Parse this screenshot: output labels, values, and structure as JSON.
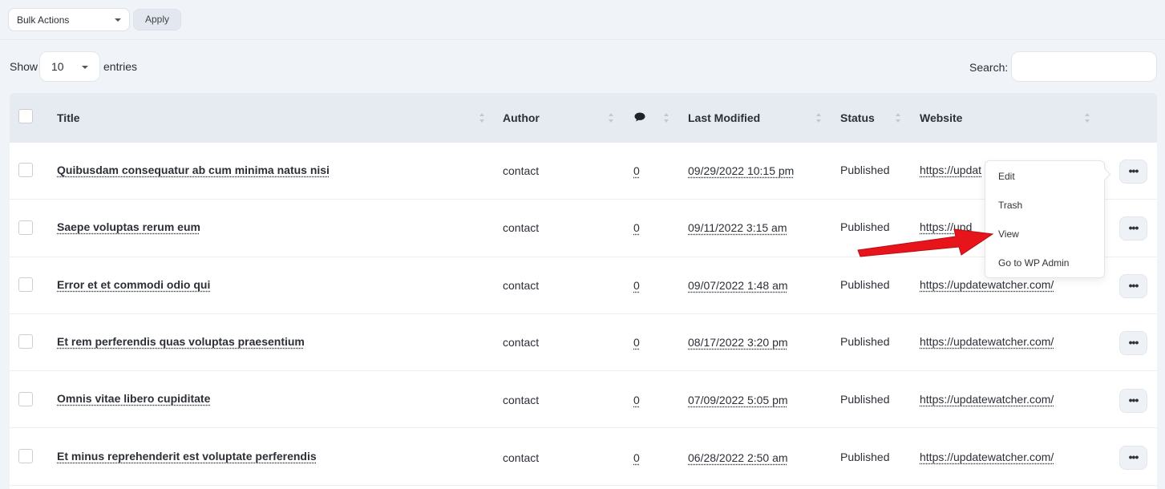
{
  "toolbar": {
    "bulk_actions": "Bulk Actions",
    "apply": "Apply"
  },
  "entries": {
    "show_label": "Show",
    "value": "10",
    "suffix": "entries"
  },
  "search": {
    "label": "Search:",
    "value": ""
  },
  "table": {
    "headers": {
      "title": "Title",
      "author": "Author",
      "comments_icon": "comment-icon",
      "last_modified": "Last Modified",
      "status": "Status",
      "website": "Website"
    },
    "rows": [
      {
        "title": "Quibusdam consequatur ab cum minima natus nisi",
        "author": "contact",
        "comments": "0",
        "modified": "09/29/2022 10:15 pm",
        "status": "Published",
        "website": "https://updat"
      },
      {
        "title": "Saepe voluptas rerum eum",
        "author": "contact",
        "comments": "0",
        "modified": "09/11/2022 3:15 am",
        "status": "Published",
        "website": "https://upd"
      },
      {
        "title": "Error et et commodi odio qui",
        "author": "contact",
        "comments": "0",
        "modified": "09/07/2022 1:48 am",
        "status": "Published",
        "website": "https://updatewatcher.com/"
      },
      {
        "title": "Et rem perferendis quas voluptas praesentium",
        "author": "contact",
        "comments": "0",
        "modified": "08/17/2022 3:20 pm",
        "status": "Published",
        "website": "https://updatewatcher.com/"
      },
      {
        "title": "Omnis vitae libero cupiditate",
        "author": "contact",
        "comments": "0",
        "modified": "07/09/2022 5:05 pm",
        "status": "Published",
        "website": "https://updatewatcher.com/"
      },
      {
        "title": "Et minus reprehenderit est voluptate perferendis",
        "author": "contact",
        "comments": "0",
        "modified": "06/28/2022 2:50 am",
        "status": "Published",
        "website": "https://updatewatcher.com/"
      }
    ],
    "more_label": "•••"
  },
  "menu": {
    "items": [
      "Edit",
      "Trash",
      "View",
      "Go to WP Admin"
    ]
  },
  "colors": {
    "page_bg": "#f0f3f8",
    "header_bg": "#e6ebf2",
    "arrow": "#e8141b"
  }
}
